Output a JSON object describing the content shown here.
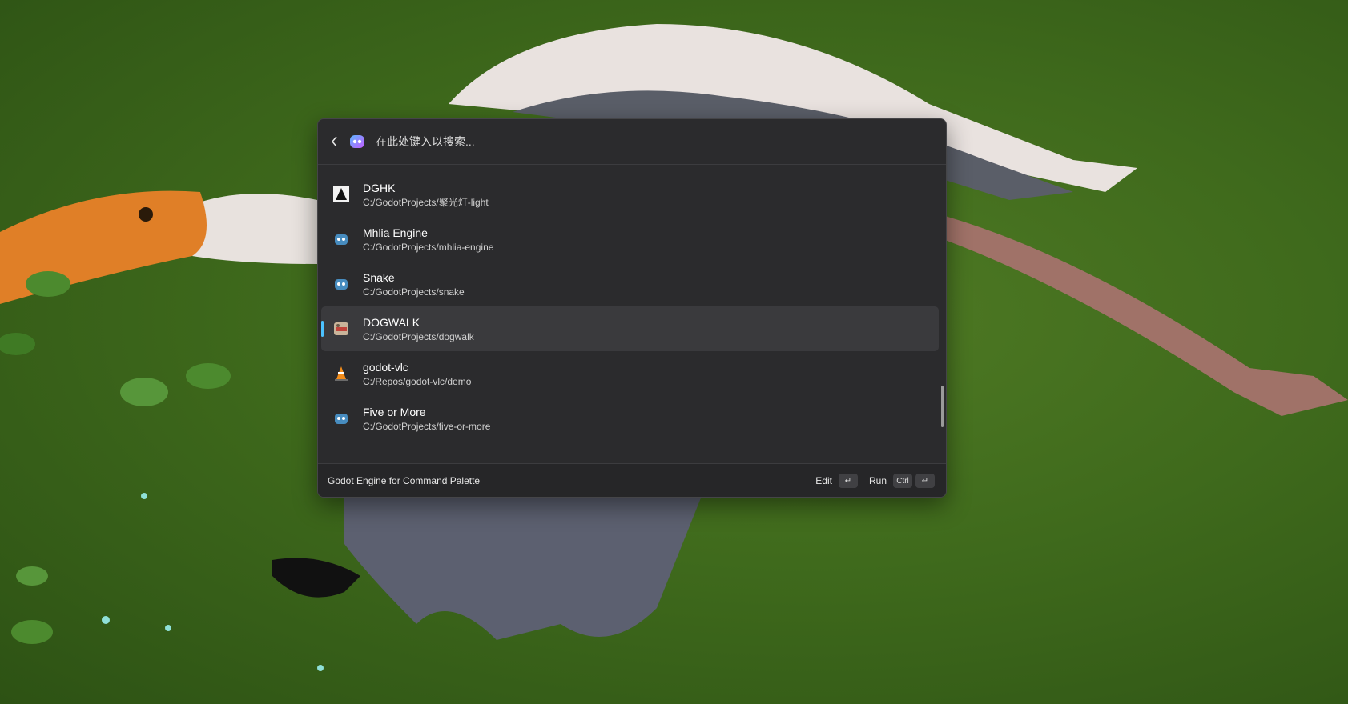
{
  "search": {
    "placeholder": "在此处键入以搜索..."
  },
  "items": [
    {
      "title": "DGHK",
      "path": "C:/GodotProjects/聚光灯-light",
      "icon": "dghk-icon",
      "selected": false
    },
    {
      "title": "Mhlia Engine",
      "path": "C:/GodotProjects/mhlia-engine",
      "icon": "godot-icon",
      "selected": false
    },
    {
      "title": "Snake",
      "path": "C:/GodotProjects/snake",
      "icon": "godot-icon",
      "selected": false
    },
    {
      "title": "DOGWALK",
      "path": "C:/GodotProjects/dogwalk",
      "icon": "dogwalk-icon",
      "selected": true
    },
    {
      "title": "godot-vlc",
      "path": "C:/Repos/godot-vlc/demo",
      "icon": "vlc-cone-icon",
      "selected": false
    },
    {
      "title": "Five or More",
      "path": "C:/GodotProjects/five-or-more",
      "icon": "godot-icon",
      "selected": false
    }
  ],
  "footer": {
    "title": "Godot Engine for Command Palette",
    "edit_label": "Edit",
    "run_label": "Run",
    "ctrl_key": "Ctrl",
    "enter_key": "↵"
  },
  "colors": {
    "accent": "#4cc2ff",
    "panel": "#2b2b2d",
    "selected_row": "#3a3a3d"
  }
}
